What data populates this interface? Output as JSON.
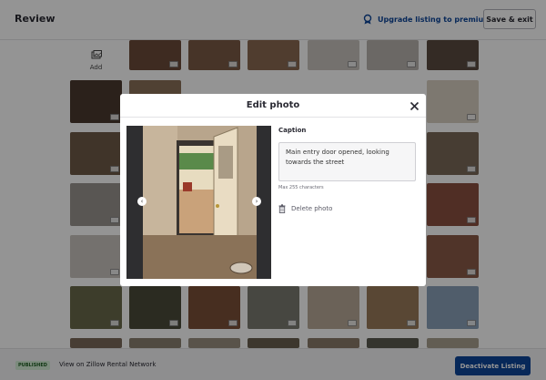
{
  "header": {
    "title": "Review",
    "upgrade_label": "Upgrade listing to premium",
    "save_exit_label": "Save & exit"
  },
  "grid": {
    "add_label": "Add"
  },
  "modal": {
    "title": "Edit photo",
    "caption_label": "Caption",
    "caption_value": "Main entry door opened, looking towards the street",
    "max_chars": "Max 255 characters",
    "delete_label": "Delete photo"
  },
  "footer": {
    "status_badge": "PUBLISHED",
    "view_link": "View on Zillow Rental Network",
    "deactivate_label": "Deactivate Listing"
  },
  "colors": {
    "brand_blue": "#0d4599",
    "published_bg": "#d6efd8"
  },
  "icons": [
    "upgrade-icon",
    "add-photo-icon",
    "close-icon",
    "prev-arrow-icon",
    "next-arrow-icon",
    "trash-icon",
    "photo-badge-icon"
  ]
}
